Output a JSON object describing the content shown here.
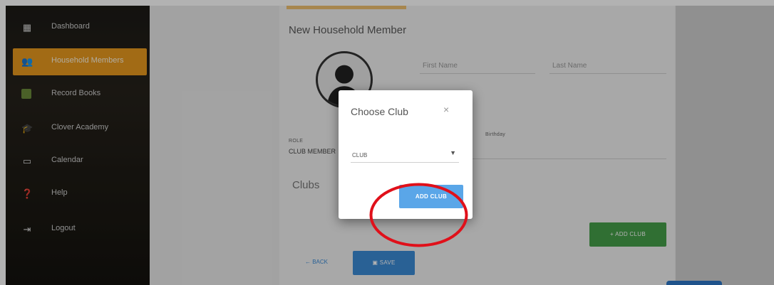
{
  "sidebar": {
    "items": [
      {
        "label": "Dashboard",
        "icon": "dashboard-icon",
        "active": false
      },
      {
        "label": "Household Members",
        "icon": "people-icon",
        "active": true
      },
      {
        "label": "Record Books",
        "icon": "book-icon",
        "active": false
      },
      {
        "label": "Clover Academy",
        "icon": "graduation-cap-icon",
        "active": false
      },
      {
        "label": "Calendar",
        "icon": "calendar-icon",
        "active": false
      },
      {
        "label": "Help",
        "icon": "help-icon",
        "active": false
      },
      {
        "label": "Logout",
        "icon": "logout-icon",
        "active": false
      }
    ]
  },
  "form": {
    "title": "New Household Member",
    "first_name_placeholder": "First Name",
    "last_name_placeholder": "Last Name",
    "birthday_label": "Birthday",
    "role_label": "ROLE",
    "role_value": "CLUB MEMBER",
    "clubs_title": "Clubs",
    "add_club_label": "+ ADD CLUB",
    "back_label": "← BACK",
    "save_label": "SAVE"
  },
  "modal": {
    "title": "Choose Club",
    "close": "×",
    "select_value": "CLUB",
    "caret": "▼",
    "add_button": "ADD CLUB"
  },
  "colors": {
    "active_nav": "#e89a1f",
    "primary_blue": "#3b8bd6",
    "modal_button": "#5aa6e8",
    "green_button": "#45a049",
    "highlight": "#e0101a"
  }
}
